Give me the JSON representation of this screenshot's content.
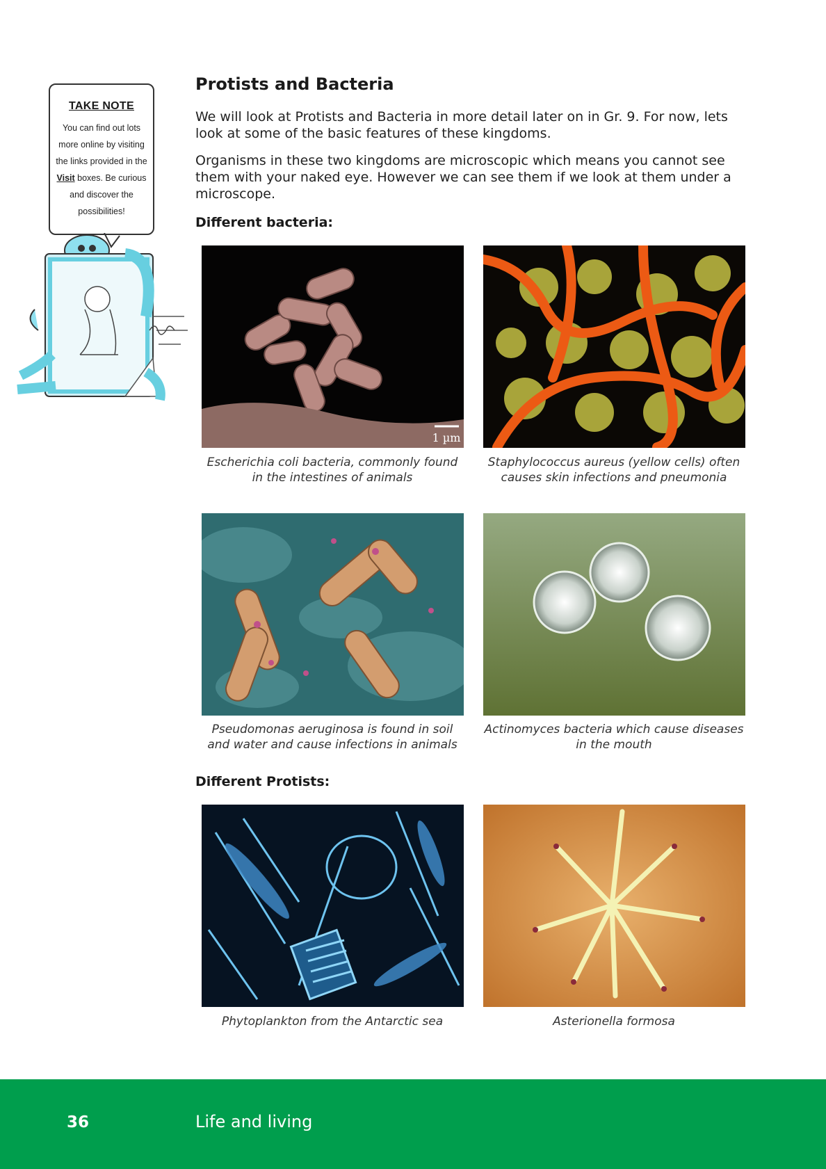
{
  "take_note": {
    "title": "TAKE NOTE",
    "body_line1": "You can find out lots",
    "body_line2": "more online by visiting",
    "body_line3": "the links provided in the",
    "body_visit": "Visit",
    "body_line4_rest": " boxes. Be curious",
    "body_line5": "and discover the",
    "body_line6": "possibilities!"
  },
  "heading": "Protists and Bacteria",
  "paragraph1": "We will look at Protists and Bacteria in more detail later on in Gr. 9. For now, lets look at some of the basic features of these kingdoms.",
  "paragraph2": "Organisms in these two kingdoms are microscopic which means you cannot see them with your naked eye. However we can see them if we look at them under a microscope.",
  "bacteria_heading": "Different bacteria:",
  "protists_heading": "Different Protists:",
  "photos": [
    {
      "caption_line1": "Escherichia coli bacteria, commonly found",
      "caption_line2": "in the intestines of animals",
      "scale_label": "1 µm"
    },
    {
      "caption_line1": "Staphylococcus aureus (yellow cells) often",
      "caption_line2": "causes skin infections and pneumonia"
    },
    {
      "caption_line1": "Pseudomonas aeruginosa is found in soil",
      "caption_line2": "and water and cause infections in animals"
    },
    {
      "caption_line1": "Actinomyces bacteria which cause diseases",
      "caption_line2": "in the mouth"
    },
    {
      "caption_line1": "Phytoplankton from the Antarctic sea",
      "caption_line2": ""
    },
    {
      "caption_line1": "Asterionella formosa",
      "caption_line2": ""
    }
  ],
  "footer": {
    "page_number": "36",
    "chapter": "Life and living",
    "color": "#009e4d"
  }
}
